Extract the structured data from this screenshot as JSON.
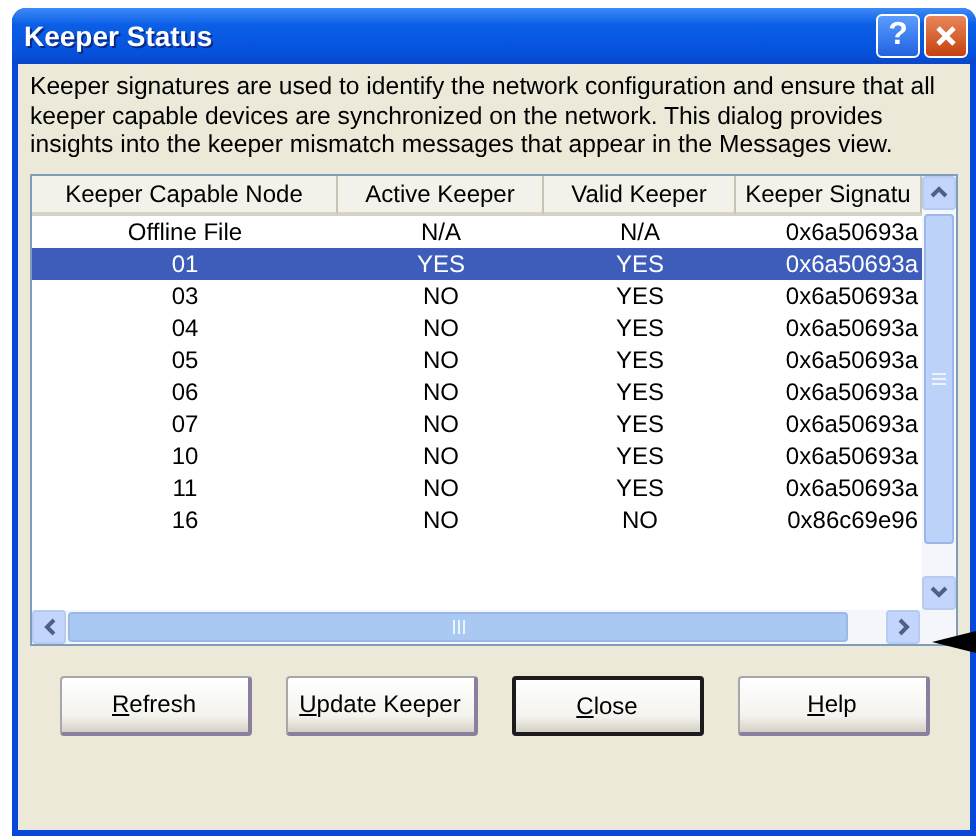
{
  "window": {
    "title": "Keeper Status",
    "help_button": "?"
  },
  "description": "Keeper signatures are used to identify the network configuration and ensure that all keeper capable devices are synchronized on the network. This dialog provides insights into the keeper mismatch messages that appear in the Messages view.",
  "table": {
    "columns": [
      "Keeper Capable Node",
      "Active Keeper",
      "Valid Keeper",
      "Keeper Signatu"
    ],
    "rows": [
      {
        "cells": [
          "Offline File",
          "N/A",
          "N/A",
          "0x6a50693a"
        ],
        "selected": false
      },
      {
        "cells": [
          "01",
          "YES",
          "YES",
          "0x6a50693a"
        ],
        "selected": true
      },
      {
        "cells": [
          "03",
          "NO",
          "YES",
          "0x6a50693a"
        ],
        "selected": false
      },
      {
        "cells": [
          "04",
          "NO",
          "YES",
          "0x6a50693a"
        ],
        "selected": false
      },
      {
        "cells": [
          "05",
          "NO",
          "YES",
          "0x6a50693a"
        ],
        "selected": false
      },
      {
        "cells": [
          "06",
          "NO",
          "YES",
          "0x6a50693a"
        ],
        "selected": false
      },
      {
        "cells": [
          "07",
          "NO",
          "YES",
          "0x6a50693a"
        ],
        "selected": false
      },
      {
        "cells": [
          "10",
          "NO",
          "YES",
          "0x6a50693a"
        ],
        "selected": false
      },
      {
        "cells": [
          "11",
          "NO",
          "YES",
          "0x6a50693a"
        ],
        "selected": false
      },
      {
        "cells": [
          "16",
          "NO",
          "NO",
          "0x86c69e96"
        ],
        "selected": false
      }
    ]
  },
  "buttons": [
    {
      "label": "Refresh",
      "default": false
    },
    {
      "label": "Update Keeper",
      "default": false
    },
    {
      "label": "Close",
      "default": true
    },
    {
      "label": "Help",
      "default": false
    }
  ]
}
